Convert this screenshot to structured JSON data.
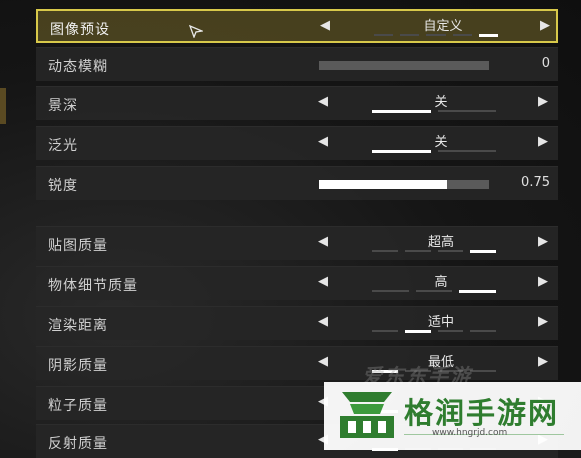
{
  "settings": [
    {
      "label": "图像预设",
      "type": "selector",
      "value": "自定义",
      "segments": 5,
      "active": 4,
      "selected": true
    },
    {
      "label": "动态模糊",
      "type": "slider",
      "fraction": 0.0,
      "value_text": "0"
    },
    {
      "label": "景深",
      "type": "selector",
      "value": "关",
      "segments": 2,
      "active": 0
    },
    {
      "label": "泛光",
      "type": "selector",
      "value": "关",
      "segments": 2,
      "active": 0
    },
    {
      "label": "锐度",
      "type": "slider",
      "fraction": 0.75,
      "value_text": "0.75"
    },
    {
      "label": "贴图质量",
      "type": "selector",
      "value": "超高",
      "segments": 4,
      "active": 3
    },
    {
      "label": "物体细节质量",
      "type": "selector",
      "value": "高",
      "segments": 3,
      "active": 2
    },
    {
      "label": "渲染距离",
      "type": "selector",
      "value": "适中",
      "segments": 4,
      "active": 1
    },
    {
      "label": "阴影质量",
      "type": "selector",
      "value": "最低",
      "segments": 4,
      "active": 0
    },
    {
      "label": "粒子质量",
      "type": "selector",
      "value": "",
      "segments": 4,
      "active": 0
    },
    {
      "label": "反射质量",
      "type": "selector",
      "value": "",
      "segments": 4,
      "active": 0
    }
  ],
  "arrows": {
    "left": "◀",
    "right": "▶"
  },
  "colors": {
    "selected_border": "#d8c94a",
    "row_bg": "#262626",
    "segment_on": "#ffffff"
  },
  "watermark": {
    "faint_text": "爱东东手游",
    "title": "格润手游网",
    "url": "www.hngrjd.com"
  }
}
